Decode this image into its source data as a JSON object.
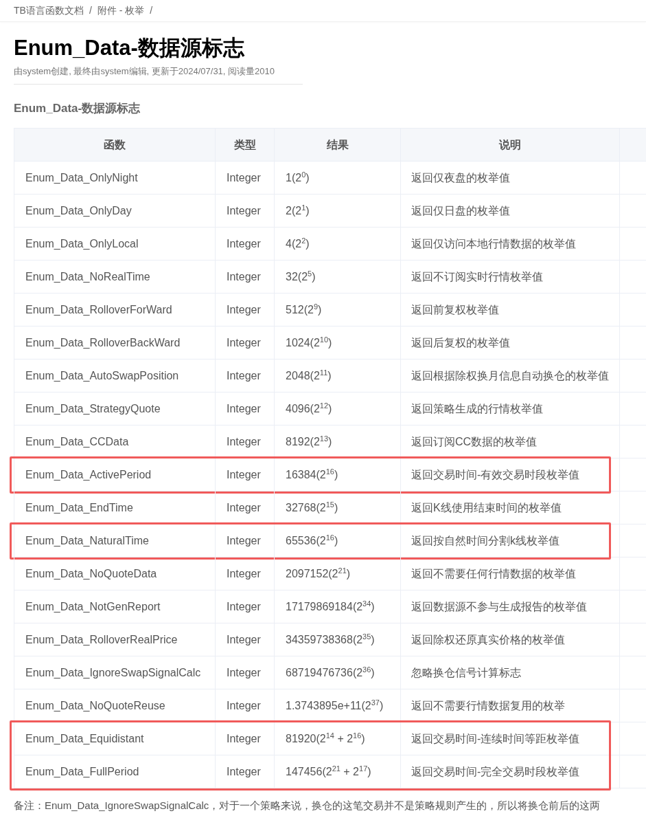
{
  "breadcrumb": {
    "separator": "/",
    "items": [
      "TB语言函数文档",
      "附件 - 枚举"
    ]
  },
  "title": "Enum_Data-数据源标志",
  "meta": "由system创建, 最终由system编辑, 更新于2024/07/31, 阅读量2010",
  "section_title": "Enum_Data-数据源标志",
  "table": {
    "columns": [
      "函数",
      "类型",
      "结果",
      "说明"
    ],
    "rows": [
      {
        "cells": [
          "Enum_Data_OnlyNight",
          "Integer",
          "1(2$^{0}$)",
          "返回仅夜盘的枚举值"
        ],
        "marked": false
      },
      {
        "cells": [
          "Enum_Data_OnlyDay",
          "Integer",
          "2(2$^{1}$)",
          "返回仅日盘的枚举值"
        ],
        "marked": false
      },
      {
        "cells": [
          "Enum_Data_OnlyLocal",
          "Integer",
          "4(2$^{2}$)",
          "返回仅访问本地行情数据的枚举值"
        ],
        "marked": false
      },
      {
        "cells": [
          "Enum_Data_NoRealTime",
          "Integer",
          "32(2$^{5}$)",
          "返回不订阅实时行情枚举值"
        ],
        "marked": false
      },
      {
        "cells": [
          "Enum_Data_RolloverForWard",
          "Integer",
          "512(2$^{9}$)",
          "返回前复权枚举值"
        ],
        "marked": false
      },
      {
        "cells": [
          "Enum_Data_RolloverBackWard",
          "Integer",
          "1024(2$^{10}$)",
          "返回后复权的枚举值"
        ],
        "marked": false
      },
      {
        "cells": [
          "Enum_Data_AutoSwapPosition",
          "Integer",
          "2048(2$^{11}$)",
          "返回根据除权换月信息自动换仓的枚举值"
        ],
        "marked": false
      },
      {
        "cells": [
          "Enum_Data_StrategyQuote",
          "Integer",
          "4096(2$^{12}$)",
          "返回策略生成的行情枚举值"
        ],
        "marked": false
      },
      {
        "cells": [
          "Enum_Data_CCData",
          "Integer",
          "8192(2$^{13}$)",
          "返回订阅CC数据的枚举值"
        ],
        "marked": false
      },
      {
        "cells": [
          "Enum_Data_ActivePeriod",
          "Integer",
          "16384(2$^{16}$)",
          "返回交易时间-有效交易时段枚举值"
        ],
        "marked": true
      },
      {
        "cells": [
          "Enum_Data_EndTime",
          "Integer",
          "32768(2$^{15}$)",
          "返回K线使用结束时间的枚举值"
        ],
        "marked": false
      },
      {
        "cells": [
          "Enum_Data_NaturalTime",
          "Integer",
          "65536(2$^{16}$)",
          "返回按自然时间分割k线枚举值"
        ],
        "marked": true
      },
      {
        "cells": [
          "Enum_Data_NoQuoteData",
          "Integer",
          "2097152(2$^{21}$)",
          "返回不需要任何行情数据的枚举值"
        ],
        "marked": false
      },
      {
        "cells": [
          "Enum_Data_NotGenReport",
          "Integer",
          "17179869184(2$^{34}$)",
          "返回数据源不参与生成报告的枚举值"
        ],
        "marked": false
      },
      {
        "cells": [
          "Enum_Data_RolloverRealPrice",
          "Integer",
          "34359738368(2$^{35}$)",
          "返回除权还原真实价格的枚举值"
        ],
        "marked": false
      },
      {
        "cells": [
          "Enum_Data_IgnoreSwapSignalCalc",
          "Integer",
          "68719476736(2$^{36}$)",
          "忽略换仓信号计算标志"
        ],
        "marked": false
      },
      {
        "cells": [
          "Enum_Data_NoQuoteReuse",
          "Integer",
          "1.3743895e+11(2$^{37}$)",
          "返回不需要行情数据复用的枚举"
        ],
        "marked": false
      },
      {
        "cells": [
          "Enum_Data_Equidistant",
          "Integer",
          "81920(2$^{14}$ + 2$^{16}$)",
          "返回交易时间-连续时间等距枚举值"
        ],
        "marked": true
      },
      {
        "cells": [
          "Enum_Data_FullPeriod",
          "Integer",
          "147456(2$^{21}$ + 2$^{17}$)",
          "返回交易时间-完全交易时段枚举值"
        ],
        "marked": true
      }
    ]
  },
  "note": "备注：Enum_Data_IgnoreSwapSignalCalc，对于一个策略来说，换仓的这笔交易并不是策略规则产生的，所以将换仓前后的这两"
}
